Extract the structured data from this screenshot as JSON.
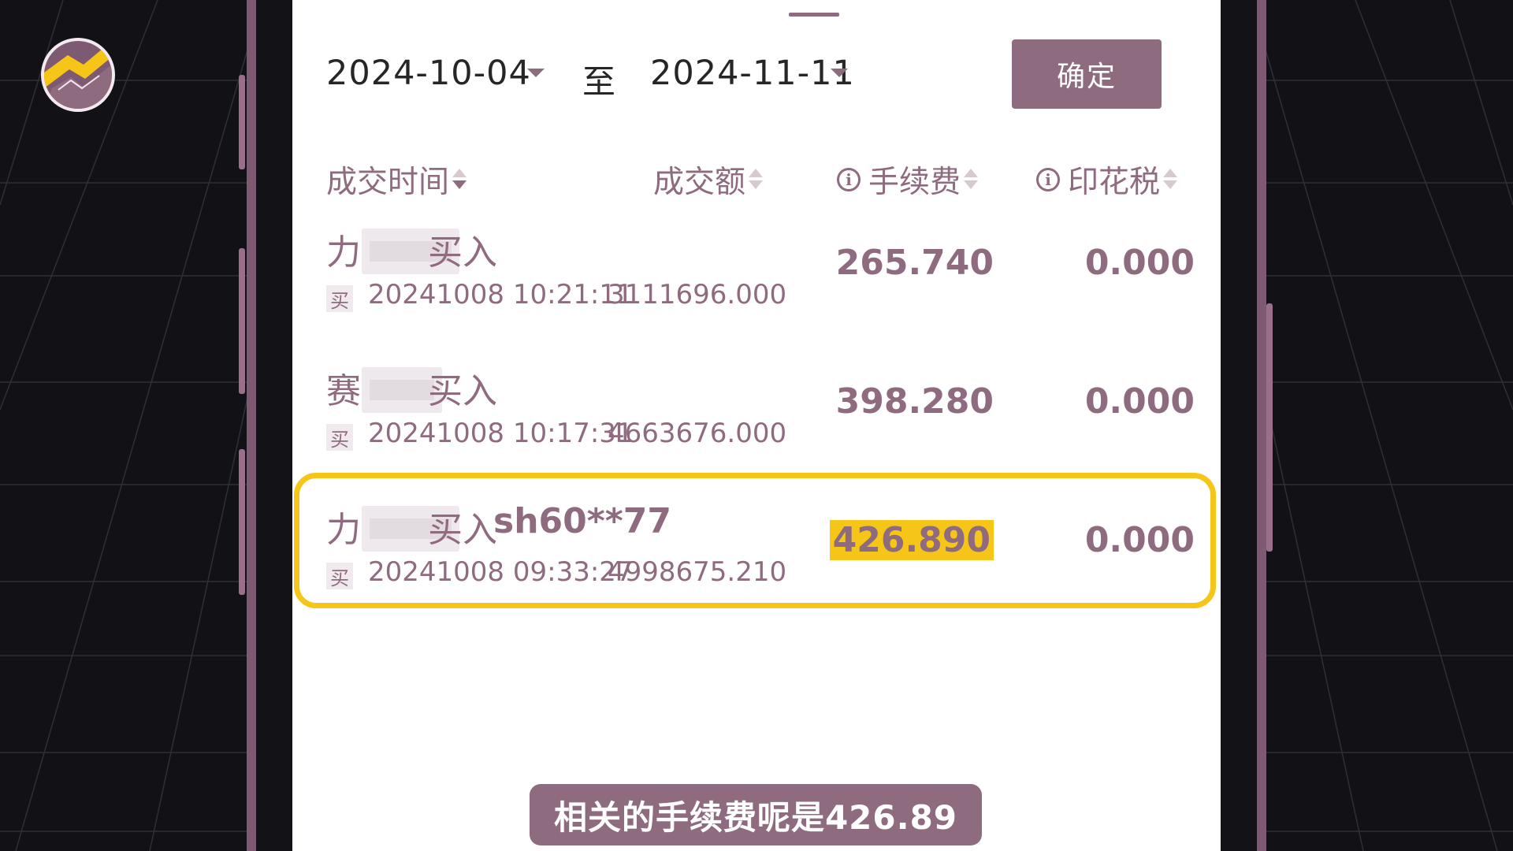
{
  "date_range": {
    "start": "2024-10-04",
    "separator": "至",
    "end": "2024-11-11",
    "confirm_label": "确定"
  },
  "columns": {
    "time": "成交时间",
    "amount": "成交额",
    "fee": "手续费",
    "tax": "印花税"
  },
  "trades": [
    {
      "name": "力",
      "code": "",
      "side": "买入",
      "tag": "买",
      "time": "20241008 10:21:11",
      "amount": "3111696.000",
      "fee": "265.740",
      "tax": "0.000"
    },
    {
      "name": "赛",
      "code": "",
      "side": "买入",
      "tag": "买",
      "time": "20241008 10:17:31",
      "amount": "4663676.000",
      "fee": "398.280",
      "tax": "0.000"
    },
    {
      "name": "力",
      "code": "sh60**77",
      "side": "买入",
      "tag": "买",
      "time": "20241008 09:33:27",
      "amount": "4998675.210",
      "fee": "426.890",
      "tax": "0.000"
    }
  ],
  "subtitle": "相关的手续费呢是426.89",
  "colors": {
    "accent": "#8f6b80",
    "highlight": "#f5c518",
    "background": "#121217"
  },
  "icons": {
    "sort": "sort-icon",
    "info": "info-icon",
    "dropdown": "chevron-down-icon"
  }
}
